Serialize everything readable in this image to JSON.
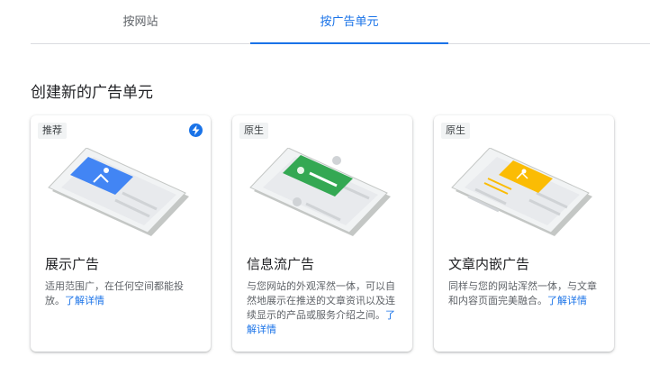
{
  "tabs": [
    {
      "label": "按网站"
    },
    {
      "label": "按广告单元"
    }
  ],
  "section_title": "创建新的广告单元",
  "cards": [
    {
      "tag": "推荐",
      "title": "展示广告",
      "desc": "适用范围广，在任何空间都能投放。",
      "learn": "了解详情",
      "accent": "#4285f4"
    },
    {
      "tag": "原生",
      "title": "信息流广告",
      "desc": "与您网站的外观浑然一体，可以自然地展示在推送的文章资讯以及连续显示的产品或服务介绍之间。",
      "learn": "了解详情",
      "accent": "#34a853"
    },
    {
      "tag": "原生",
      "title": "文章内嵌广告",
      "desc": "同样与您的网站浑然一体，与文章和内容页面完美融合。",
      "learn": "了解详情",
      "accent": "#fbbc04"
    }
  ],
  "colors": {
    "accent": "#1a73e8",
    "green": "#34a853",
    "yellow": "#fbbc04",
    "blue": "#4285f4"
  },
  "icons": {
    "recommended": "bolt-icon"
  }
}
